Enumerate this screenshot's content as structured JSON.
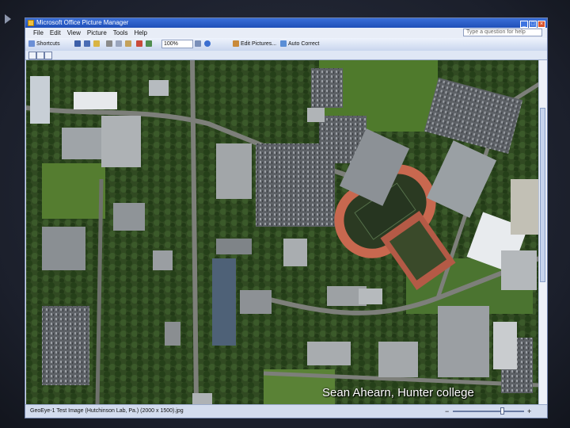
{
  "window": {
    "title": "Microsoft Office Picture Manager",
    "menus": [
      "File",
      "Edit",
      "View",
      "Picture",
      "Tools",
      "Help"
    ],
    "help_placeholder": "Type a question for help"
  },
  "toolbar": {
    "shortcuts_label": "Shortcuts",
    "zoom_value": "100%",
    "edit_pictures_label": "Edit Pictures...",
    "auto_correct_label": "Auto Correct"
  },
  "statusbar": {
    "file_text": "GeoEye-1 Test Image (Hutchinson Lab, Pa.) (2000 x 1500).jpg"
  },
  "caption": "Sean Ahearn, Hunter college",
  "colors": {
    "title_blue": "#1f4fb8",
    "track_red": "#c8684f",
    "field_green": "#2b3a22"
  }
}
